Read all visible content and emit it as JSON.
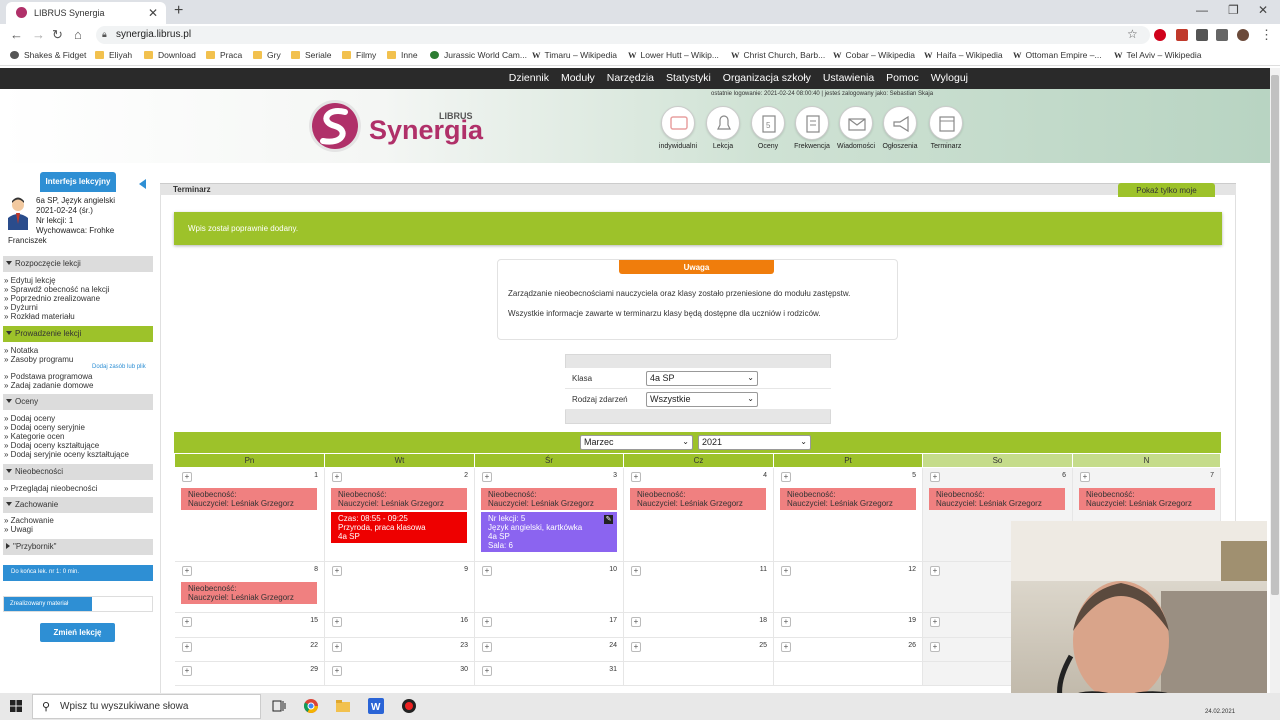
{
  "browser": {
    "tab_title": "LIBRUS Synergia",
    "url": "synergia.librus.pl",
    "bookmarks": [
      {
        "label": "Shakes & Fidget",
        "kind": "app"
      },
      {
        "label": "Eliyah",
        "kind": "folder"
      },
      {
        "label": "Download",
        "kind": "folder"
      },
      {
        "label": "Praca",
        "kind": "folder"
      },
      {
        "label": "Gry",
        "kind": "folder"
      },
      {
        "label": "Seriale",
        "kind": "folder"
      },
      {
        "label": "Filmy",
        "kind": "folder"
      },
      {
        "label": "Inne",
        "kind": "folder"
      },
      {
        "label": "Jurassic World Cam...",
        "kind": "site"
      },
      {
        "label": "Timaru – Wikipedia",
        "kind": "wiki"
      },
      {
        "label": "Lower Hutt – Wikip...",
        "kind": "wiki"
      },
      {
        "label": "Christ Church, Barb...",
        "kind": "wiki"
      },
      {
        "label": "Cobar – Wikipedia",
        "kind": "wiki"
      },
      {
        "label": "Haifa – Wikipedia",
        "kind": "wiki"
      },
      {
        "label": "Ottoman Empire –...",
        "kind": "wiki"
      },
      {
        "label": "Tel Aviv – Wikipedia",
        "kind": "wiki"
      }
    ]
  },
  "topnav": [
    "Dziennik",
    "Moduły",
    "Narzędzia",
    "Statystyki",
    "Organizacja szkoły",
    "Ustawienia",
    "Pomoc",
    "Wyloguj"
  ],
  "header": {
    "login_info": "ostatnie logowanie: 2021-02-24 08:00:40   |   jesteś zalogowany jako: Sebastian Skaja",
    "logo_brand": "LIBRUS",
    "logo_name": "Synergia",
    "modules": [
      "indywidualni",
      "Lekcja",
      "Oceny",
      "Frekwencja",
      "Wiadomości",
      "Ogłoszenia",
      "Terminarz"
    ]
  },
  "sidebar": {
    "tab_label": "Interfejs lekcyjny",
    "lesson": {
      "line1": "6a SP, Język angielski",
      "line2": "2021-02-24 (śr.)",
      "line3": "Nr lekcji: 1",
      "line4": "Wychowawca: Frohke",
      "line5": "Franciszek"
    },
    "sections": [
      {
        "title": "Rozpoczęcie lekcji",
        "items": [
          "Edytuj lekcję",
          "Sprawdź obecność na lekcji",
          "Poprzednio zrealizowane",
          "Dyżurni",
          "Rozkład materiału"
        ]
      },
      {
        "title": "Prowadzenie lekcji",
        "items": [
          "Notatka",
          "Zasoby programu",
          "Podstawa programowa",
          "Zadaj zadanie domowe"
        ]
      },
      {
        "title": "Oceny",
        "items": [
          "Dodaj oceny",
          "Dodaj oceny seryjnie",
          "Kategorie ocen",
          "Dodaj oceny kształtujące",
          "Dodaj seryjnie oceny kształtujące"
        ]
      },
      {
        "title": "Nieobecności",
        "items": [
          "Przeglądaj nieobecności"
        ]
      },
      {
        "title": "Zachowanie",
        "items": [
          "Zachowanie",
          "Uwagi"
        ]
      },
      {
        "title": "\"Przybornik\"",
        "items": []
      }
    ],
    "add_resource": "Dodaj zasób lub plik",
    "countdown": "Do końca lek. nr 1: 0 min.",
    "realized_label": "Zrealizowany materiał",
    "realized_fraction": 0.58,
    "change_button": "Zmień lekcję"
  },
  "main": {
    "title": "Terminarz",
    "show_mine": "Pokaż tylko moje",
    "success": "Wpis został poprawnie dodany.",
    "notice": {
      "title": "Uwaga",
      "line1": "Zarządzanie nieobecnościami nauczyciela oraz klasy zostało przeniesione do modułu zastępstw.",
      "line2": "Wszystkie informacje zawarte w terminarzu klasy będą dostępne dla uczniów i rodziców."
    },
    "filters": {
      "class_label": "Klasa",
      "class_value": "4a SP",
      "event_label": "Rodzaj zdarzeń",
      "event_value": "Wszystkie"
    },
    "calendar": {
      "month": "Marzec",
      "year": "2021",
      "days": [
        "Pn",
        "Wt",
        "Śr",
        "Cz",
        "Pt",
        "So",
        "N"
      ],
      "weeks": [
        [
          "1",
          "2",
          "3",
          "4",
          "5",
          "6",
          "7"
        ],
        [
          "8",
          "9",
          "10",
          "11",
          "12",
          "13",
          "14"
        ],
        [
          "15",
          "16",
          "17",
          "18",
          "19",
          "20",
          "21"
        ],
        [
          "22",
          "23",
          "24",
          "25",
          "26",
          "27",
          "28"
        ],
        [
          "29",
          "30",
          "31",
          "",
          "",
          "",
          ""
        ]
      ],
      "absence_title": "Nieobecność:",
      "absence_teacher": "Nauczyciel: Leśniak Grzegorz",
      "red_event": {
        "time": "Czas: 08:55 - 09:25",
        "title": "Przyroda, praca klasowa",
        "class": "4a SP"
      },
      "purple_event": {
        "lesson": "Nr lekcji: 5",
        "title": "Język angielski, kartkówka",
        "class": "4a SP",
        "room": "Sala: 6"
      }
    }
  },
  "taskbar": {
    "search_placeholder": "Wpisz tu wyszukiwane słowa",
    "clock": "24.02.2021"
  },
  "colors": {
    "accent_green": "#9dc22a",
    "accent_blue": "#2e8fd4",
    "warning_orange": "#f07d0c",
    "absence_pink": "#f08080",
    "test_red": "#ee0000",
    "quiz_purple": "#8b64f0"
  }
}
